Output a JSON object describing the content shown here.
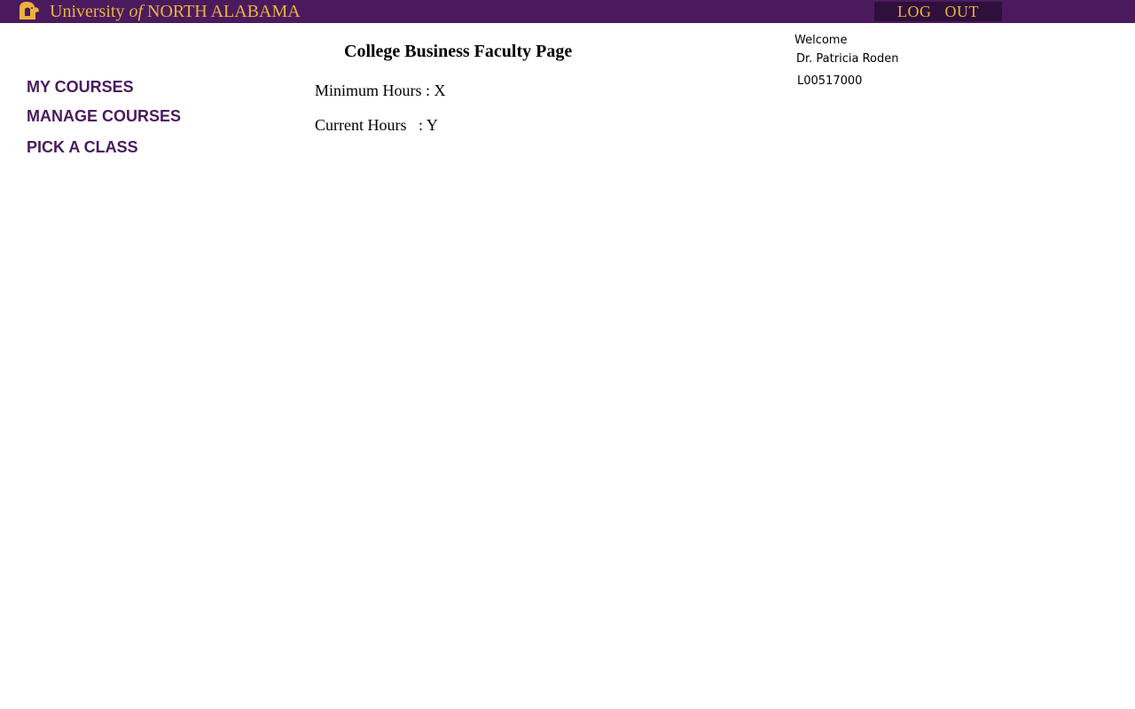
{
  "header": {
    "brand_prefix": "University ",
    "brand_of": "of",
    "brand_suffix": " NORTH ALABAMA",
    "logout_label": "LOG   OUT",
    "bar_color": "#4b1a5e",
    "accent_color": "#e8b33a",
    "logo_icon": "lion-head-icon"
  },
  "sidebar": {
    "items": [
      {
        "label": "MY COURSES"
      },
      {
        "label": "MANAGE COURSES"
      },
      {
        "label": "PICK A CLASS"
      }
    ]
  },
  "main": {
    "title": "College Business Faculty Page",
    "minimum_hours": "Minimum Hours : X",
    "current_hours": "Current Hours   : Y"
  },
  "user": {
    "welcome": "Welcome",
    "name": "Dr. Patricia Roden",
    "id": "L00517000"
  }
}
